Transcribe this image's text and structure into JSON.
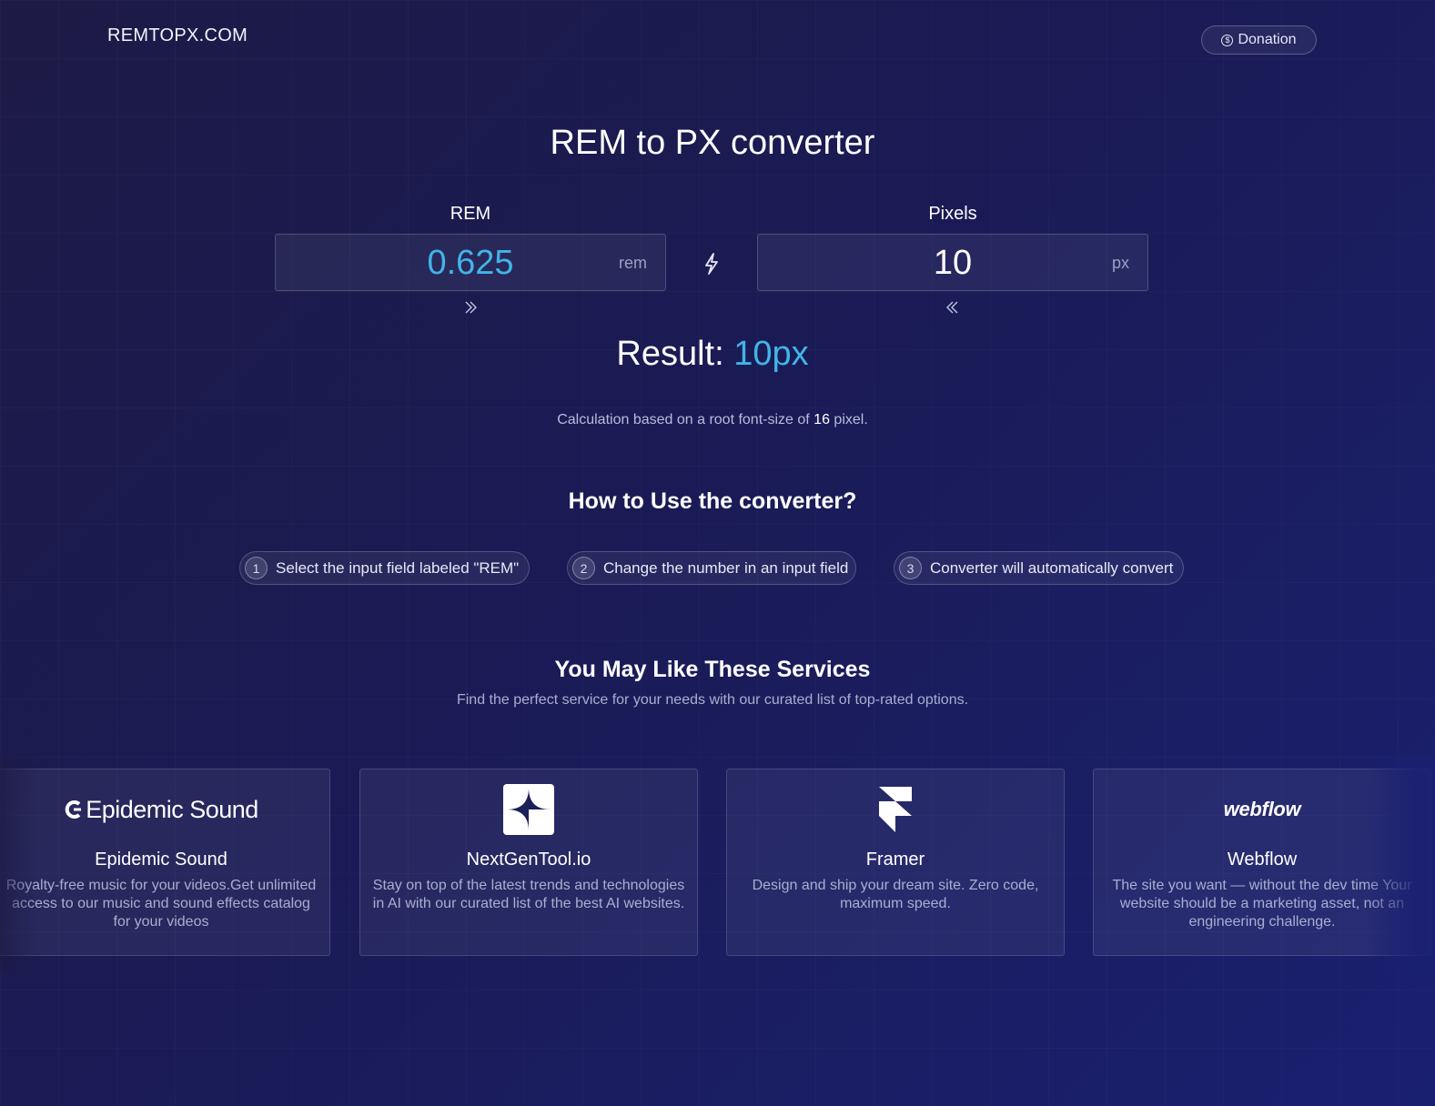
{
  "header": {
    "logo": "REMTOPX.COM",
    "donation_label": "Donation",
    "donation_icon": "dollar-coin-icon"
  },
  "converter": {
    "title": "REM to PX converter",
    "rem": {
      "label": "REM",
      "value": "0.625",
      "unit": "rem"
    },
    "px": {
      "label": "Pixels",
      "value": "10",
      "unit": "px"
    },
    "swap_icon": "lightning-icon",
    "result_label": "Result:",
    "result_value": "10px",
    "calc_prefix": "Calculation based on a root font-size of",
    "calc_value": "16",
    "calc_suffix": "pixel.",
    "accent_color": "#42b4e6"
  },
  "howto": {
    "title": "How to Use the converter?",
    "steps": [
      {
        "num": "1",
        "text": "Select the input field labeled \"REM\""
      },
      {
        "num": "2",
        "text": "Change the number in an input field"
      },
      {
        "num": "3",
        "text": "Converter will automatically convert"
      }
    ]
  },
  "services": {
    "title": "You May Like These Services",
    "subtitle": "Find the perfect service for your needs with our curated list of top-rated options.",
    "cards": [
      {
        "logo_text": "Epidemic Sound",
        "name": "Epidemic Sound",
        "description": "Royalty-free music for your videos.Get unlimited access to our music and sound effects catalog for your videos"
      },
      {
        "logo_text": "",
        "name": "NextGenTool.io",
        "description": "Stay on top of the latest trends and technologies in AI with our curated list of the best AI websites."
      },
      {
        "logo_text": "",
        "name": "Framer",
        "description": "Design and ship your dream site. Zero code, maximum speed."
      },
      {
        "logo_text": "webflow",
        "name": "Webflow",
        "description": "The site you want — without the dev time Your website should be a marketing asset, not an engineering challenge."
      }
    ]
  }
}
